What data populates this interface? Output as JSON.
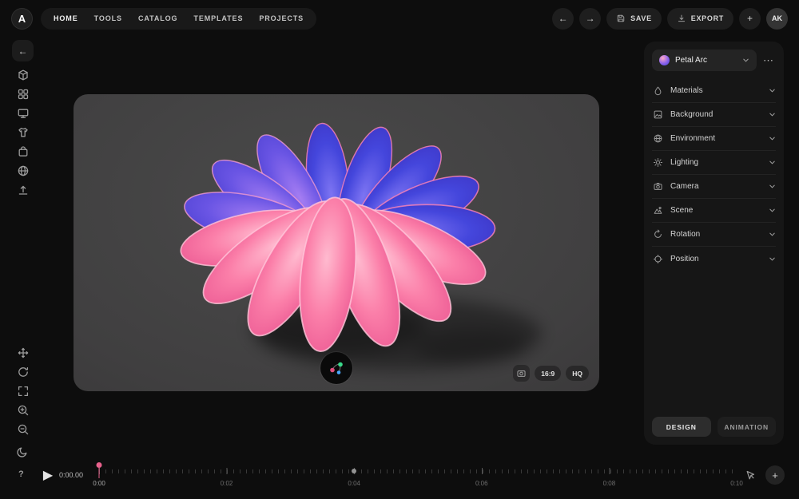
{
  "topbar": {
    "logo_text": "A",
    "nav": [
      "HOME",
      "TOOLS",
      "CATALOG",
      "TEMPLATES",
      "PROJECTS"
    ],
    "save_label": "SAVE",
    "export_label": "EXPORT",
    "avatar_initials": "AK"
  },
  "icons": {
    "back": "←",
    "forward": "→",
    "add": "+",
    "more": "⋯",
    "help": "?",
    "play": "▶"
  },
  "canvas": {
    "aspect_ratio": "16:9",
    "quality": "HQ"
  },
  "panel": {
    "selected_object": "Petal Arc",
    "sections": [
      {
        "label": "Materials"
      },
      {
        "label": "Background"
      },
      {
        "label": "Environment"
      },
      {
        "label": "Lighting"
      },
      {
        "label": "Camera"
      },
      {
        "label": "Scene"
      },
      {
        "label": "Rotation"
      },
      {
        "label": "Position"
      }
    ],
    "tabs": [
      {
        "label": "DESIGN",
        "active": true
      },
      {
        "label": "ANIMATION",
        "active": false
      }
    ]
  },
  "timeline": {
    "current_time": "0:00.00",
    "tick_labels": [
      "0:00",
      "0:02",
      "0:04",
      "0:06",
      "0:08",
      "0:10"
    ],
    "keyframe_time": "0:04"
  },
  "colors": {
    "accent_pink": "#e8618c",
    "petal_pink": "#f2699c",
    "petal_blue": "#4345d8",
    "canvas_bg": "#3e3e3e"
  }
}
